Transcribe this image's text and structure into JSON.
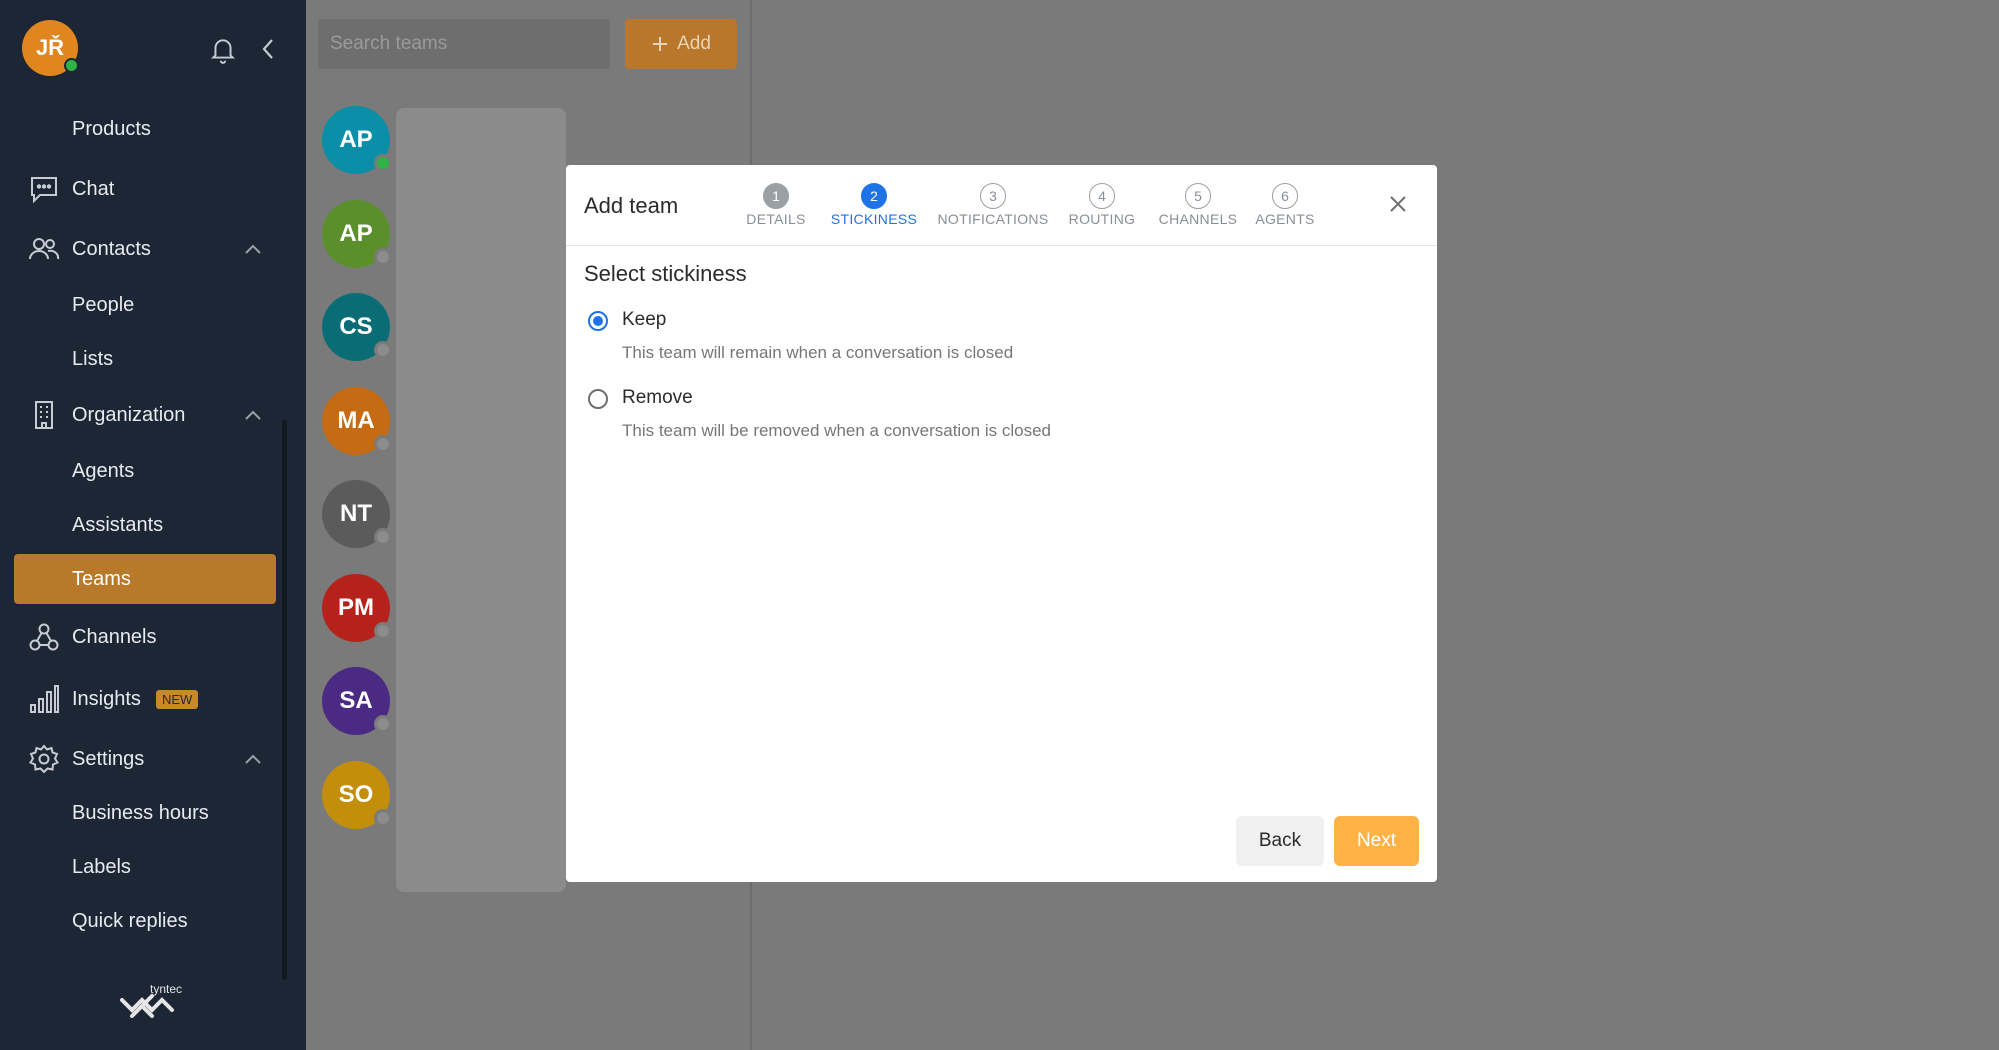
{
  "user": {
    "initials": "JŘ"
  },
  "sidebar": {
    "items": [
      {
        "label": "Products"
      },
      {
        "label": "Chat"
      },
      {
        "label": "Contacts"
      },
      {
        "label": "People"
      },
      {
        "label": "Lists"
      },
      {
        "label": "Organization"
      },
      {
        "label": "Agents"
      },
      {
        "label": "Assistants"
      },
      {
        "label": "Teams"
      },
      {
        "label": "Channels"
      },
      {
        "label": "Insights",
        "badge": "NEW"
      },
      {
        "label": "Settings"
      },
      {
        "label": "Business hours"
      },
      {
        "label": "Labels"
      },
      {
        "label": "Quick replies"
      }
    ],
    "active_item": "Teams",
    "logo_text": "tyntec"
  },
  "teams": {
    "search_placeholder": "Search teams",
    "add_label": "Add",
    "avatars": [
      {
        "initials": "AP",
        "color": "#0b8ea7",
        "online": true
      },
      {
        "initials": "AP",
        "color": "#5a8f2c",
        "online": false
      },
      {
        "initials": "CS",
        "color": "#0a6d76",
        "online": false
      },
      {
        "initials": "MA",
        "color": "#c46b14",
        "online": false
      },
      {
        "initials": "NT",
        "color": "#5b5b5b",
        "online": false
      },
      {
        "initials": "PM",
        "color": "#b5221b",
        "online": false
      },
      {
        "initials": "SA",
        "color": "#4a2a82",
        "online": false
      },
      {
        "initials": "SO",
        "color": "#c48e0d",
        "online": false
      }
    ]
  },
  "modal": {
    "title": "Add team",
    "steps": [
      {
        "num": "1",
        "label": "DETAILS",
        "state": "done"
      },
      {
        "num": "2",
        "label": "STICKINESS",
        "state": "current"
      },
      {
        "num": "3",
        "label": "NOTIFICATIONS",
        "state": "todo"
      },
      {
        "num": "4",
        "label": "ROUTING",
        "state": "todo"
      },
      {
        "num": "5",
        "label": "CHANNELS",
        "state": "todo"
      },
      {
        "num": "6",
        "label": "AGENTS",
        "state": "todo"
      }
    ],
    "section_title": "Select stickiness",
    "options": [
      {
        "label": "Keep",
        "description": "This team will remain when a conversation is closed",
        "selected": true
      },
      {
        "label": "Remove",
        "description": "This team will be removed when a conversation is closed",
        "selected": false
      }
    ],
    "back_label": "Back",
    "next_label": "Next"
  },
  "colors": {
    "accent": "#1f73e6",
    "primary_button": "#ffb347",
    "sidebar_bg": "#1c2635",
    "active_nav": "#b87a2a"
  }
}
